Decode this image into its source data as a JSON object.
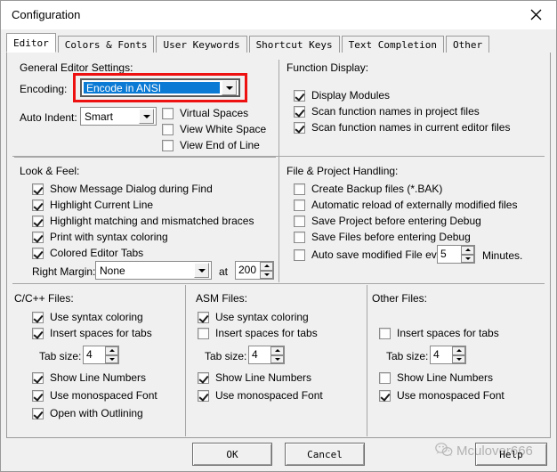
{
  "window": {
    "title": "Configuration",
    "close_icon": "close-icon"
  },
  "tabs": [
    {
      "label": "Editor",
      "active": true
    },
    {
      "label": "Colors & Fonts",
      "active": false
    },
    {
      "label": "User Keywords",
      "active": false
    },
    {
      "label": "Shortcut Keys",
      "active": false
    },
    {
      "label": "Text Completion",
      "active": false
    },
    {
      "label": "Other",
      "active": false
    }
  ],
  "general_editor_settings": {
    "title": "General Editor Settings:",
    "encoding_label": "Encoding:",
    "encoding_value": "Encode in ANSI",
    "encoding_highlighted": true,
    "auto_indent_label": "Auto Indent:",
    "auto_indent_value": "Smart",
    "checkboxes": [
      {
        "label": "Virtual Spaces",
        "checked": false
      },
      {
        "label": "View White Space",
        "checked": false
      },
      {
        "label": "View End of Line",
        "checked": false
      }
    ]
  },
  "function_display": {
    "title": "Function Display:",
    "checkboxes": [
      {
        "label": "Display Modules",
        "checked": true
      },
      {
        "label": "Scan function names in project files",
        "checked": true
      },
      {
        "label": "Scan function names in current editor files",
        "checked": true
      }
    ]
  },
  "look_and_feel": {
    "title": "Look & Feel:",
    "checkboxes": [
      {
        "label": "Show Message Dialog during Find",
        "checked": true
      },
      {
        "label": "Highlight Current Line",
        "checked": true
      },
      {
        "label": "Highlight matching and mismatched braces",
        "checked": true
      },
      {
        "label": "Print with syntax coloring",
        "checked": true
      },
      {
        "label": "Colored Editor Tabs",
        "checked": true
      }
    ],
    "right_margin_label": "Right Margin:",
    "right_margin_value": "None",
    "at_label": "at",
    "at_value": "200"
  },
  "file_project_handling": {
    "title": "File & Project Handling:",
    "checkboxes": [
      {
        "label": "Create Backup files (*.BAK)",
        "checked": false
      },
      {
        "label": "Automatic reload of externally modified files",
        "checked": false
      },
      {
        "label": "Save Project before entering Debug",
        "checked": false
      },
      {
        "label": "Save Files before entering Debug",
        "checked": false
      },
      {
        "label": "Auto save modified File every",
        "checked": false
      }
    ],
    "auto_save_minutes": "5",
    "minutes_label": "Minutes."
  },
  "c_cpp_files": {
    "title": "C/C++ Files:",
    "checkboxes_top": [
      {
        "label": "Use syntax coloring",
        "checked": true
      },
      {
        "label": "Insert spaces for tabs",
        "checked": true
      }
    ],
    "tab_size_label": "Tab size:",
    "tab_size_value": "4",
    "checkboxes_bottom": [
      {
        "label": "Show Line Numbers",
        "checked": true
      },
      {
        "label": "Use monospaced Font",
        "checked": true
      },
      {
        "label": "Open with Outlining",
        "checked": true
      }
    ]
  },
  "asm_files": {
    "title": "ASM Files:",
    "checkboxes_top": [
      {
        "label": "Use syntax coloring",
        "checked": true
      },
      {
        "label": "Insert spaces for tabs",
        "checked": false
      }
    ],
    "tab_size_label": "Tab size:",
    "tab_size_value": "4",
    "checkboxes_bottom": [
      {
        "label": "Show Line Numbers",
        "checked": true
      },
      {
        "label": "Use monospaced Font",
        "checked": true
      }
    ]
  },
  "other_files": {
    "title": "Other Files:",
    "checkboxes_top": [
      {
        "label": "Insert spaces for tabs",
        "checked": false
      }
    ],
    "tab_size_label": "Tab size:",
    "tab_size_value": "4",
    "checkboxes_bottom": [
      {
        "label": "Show Line Numbers",
        "checked": false
      },
      {
        "label": "Use monospaced Font",
        "checked": true
      }
    ]
  },
  "buttons": {
    "ok": "OK",
    "cancel": "Cancel",
    "help": "Help"
  },
  "watermark": {
    "text": "Mculover666",
    "icon": "wechat-icon"
  },
  "colors": {
    "highlight_red": "#ee1111",
    "selection_blue": "#0a7ad4",
    "dialog_face": "#f0f0f0"
  }
}
